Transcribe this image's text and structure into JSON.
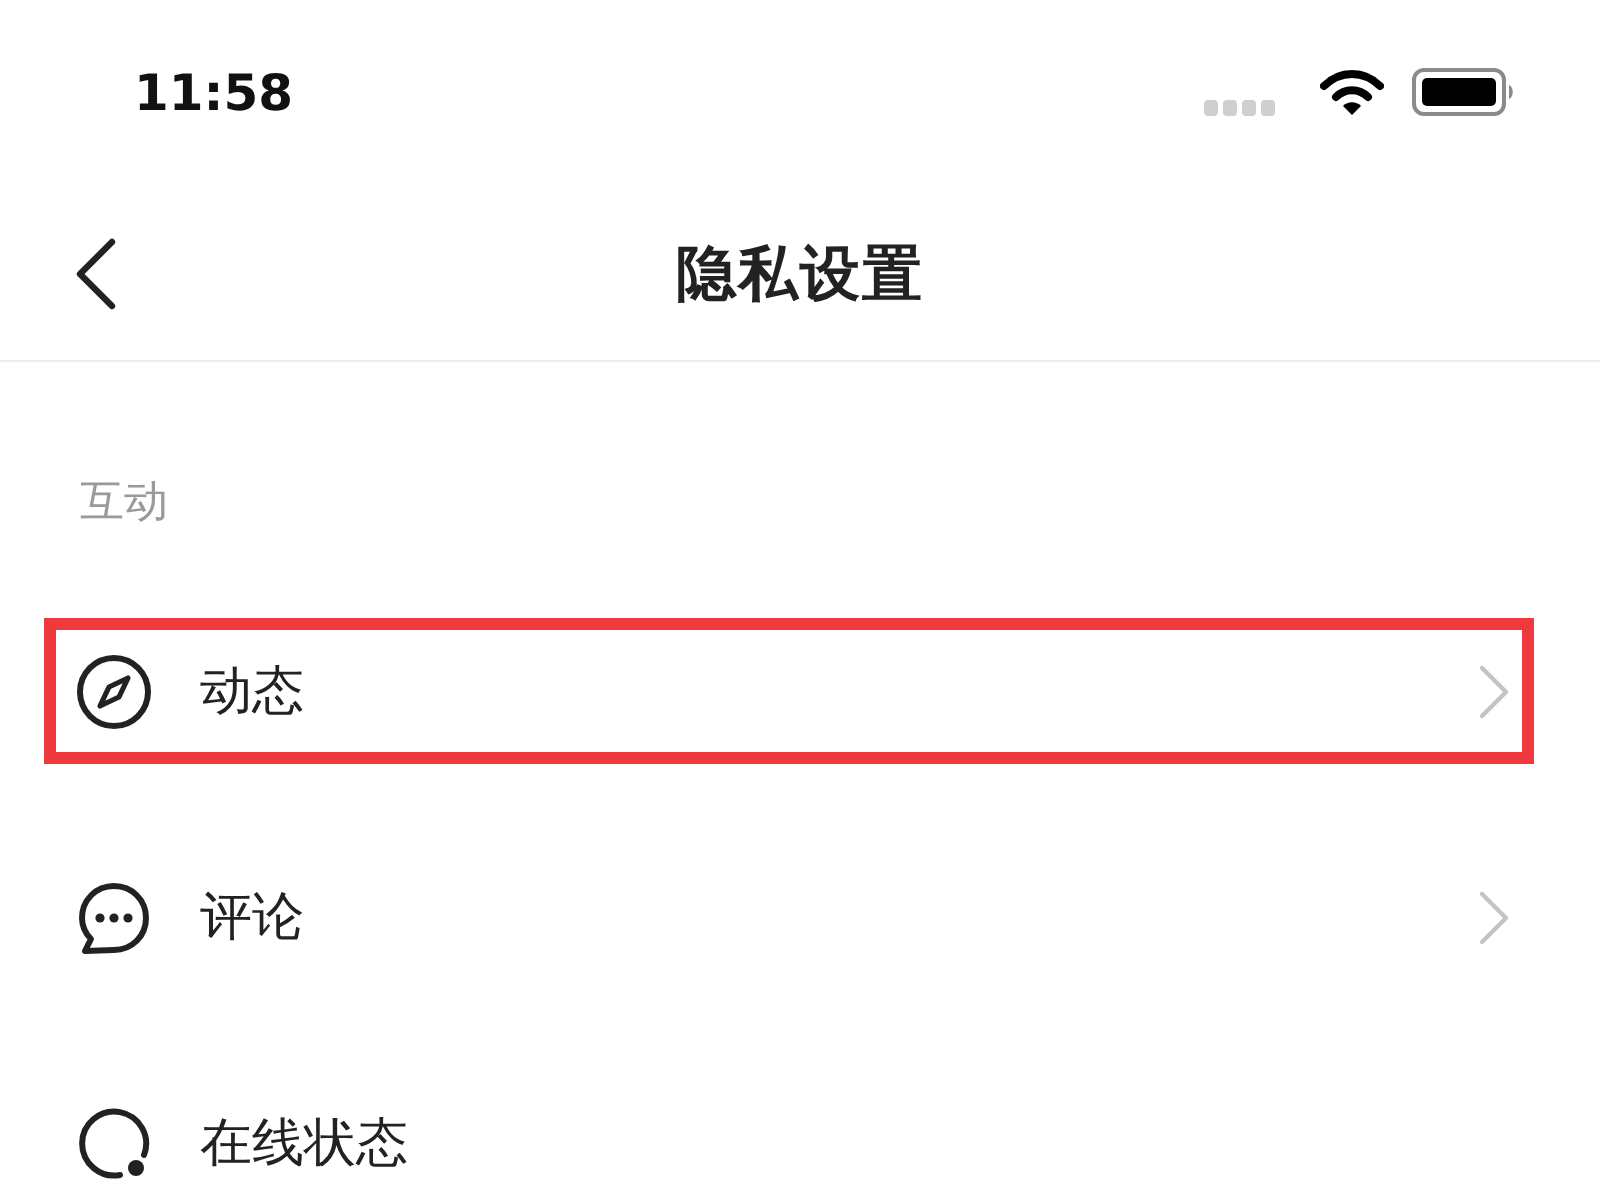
{
  "status_bar": {
    "time": "11:58"
  },
  "nav_bar": {
    "title": "隐私设置"
  },
  "sections": [
    {
      "title": "互动",
      "items": [
        {
          "label": "动态",
          "kind": "compass",
          "chevron": true,
          "highlighted": true
        },
        {
          "label": "评论",
          "kind": "comment",
          "chevron": true,
          "highlighted": false
        },
        {
          "label": "在线状态",
          "kind": "status",
          "chevron": false,
          "highlighted": false
        }
      ]
    }
  ]
}
